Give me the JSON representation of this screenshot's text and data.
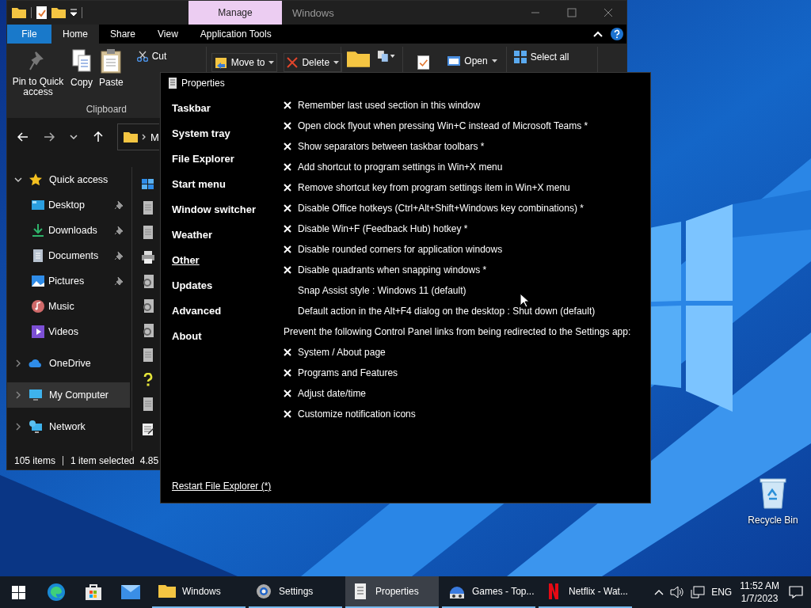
{
  "explorer": {
    "context_tab": "Manage",
    "title": "Windows",
    "ribbon_tabs": [
      {
        "label": "File",
        "kind": "file",
        "selected": false
      },
      {
        "label": "Home",
        "kind": "tab",
        "selected": true
      },
      {
        "label": "Share",
        "kind": "tab",
        "selected": false
      },
      {
        "label": "View",
        "kind": "tab",
        "selected": false
      },
      {
        "label": "Application Tools",
        "kind": "tab",
        "selected": false
      }
    ],
    "ribbon": {
      "pin": "Pin to Quick access",
      "copy": "Copy",
      "paste": "Paste",
      "cut": "Cut",
      "clipboard_label": "Clipboard",
      "move_to": "Move to",
      "delete": "Delete",
      "open": "Open",
      "select_all": "Select all"
    },
    "address": "M",
    "nav": [
      {
        "label": "Quick access",
        "kind": "star",
        "expanded": true,
        "selected": false,
        "children": [
          {
            "label": "Desktop",
            "kind": "desktop",
            "pinned": true,
            "selected": false
          },
          {
            "label": "Downloads",
            "kind": "downloads",
            "pinned": true,
            "selected": false
          },
          {
            "label": "Documents",
            "kind": "documents",
            "pinned": true,
            "selected": false
          },
          {
            "label": "Pictures",
            "kind": "pictures",
            "pinned": true,
            "selected": false
          },
          {
            "label": "Music",
            "kind": "music",
            "pinned": false,
            "selected": false
          },
          {
            "label": "Videos",
            "kind": "videos",
            "pinned": false,
            "selected": false
          }
        ]
      },
      {
        "label": "OneDrive",
        "kind": "cloud",
        "expanded": false,
        "selected": false
      },
      {
        "label": "My Computer",
        "kind": "computer",
        "expanded": false,
        "selected": true
      },
      {
        "label": "Network",
        "kind": "network",
        "expanded": false,
        "selected": false
      }
    ],
    "status": {
      "count": "105 items",
      "selection": "1 item selected",
      "size": "4.85"
    }
  },
  "properties": {
    "title": "Properties",
    "sections": [
      {
        "label": "Taskbar",
        "selected": false
      },
      {
        "label": "System tray",
        "selected": false
      },
      {
        "label": "File Explorer",
        "selected": false
      },
      {
        "label": "Start menu",
        "selected": false
      },
      {
        "label": "Window switcher",
        "selected": false
      },
      {
        "label": "Weather",
        "selected": false
      },
      {
        "label": "Other",
        "selected": true
      },
      {
        "label": "Updates",
        "selected": false
      },
      {
        "label": "Advanced",
        "selected": false
      },
      {
        "label": "About",
        "selected": false
      }
    ],
    "options": [
      {
        "kind": "check",
        "label": "Remember last used section in this window",
        "checked": true
      },
      {
        "kind": "check",
        "label": "Open clock flyout when pressing Win+C instead of Microsoft Teams *",
        "checked": true
      },
      {
        "kind": "check",
        "label": "Show separators between taskbar toolbars *",
        "checked": true
      },
      {
        "kind": "check",
        "label": "Add shortcut to program settings in Win+X menu",
        "checked": true
      },
      {
        "kind": "check",
        "label": "Remove shortcut key from program settings item in Win+X menu",
        "checked": true
      },
      {
        "kind": "check",
        "label": "Disable Office hotkeys (Ctrl+Alt+Shift+Windows key combinations) *",
        "checked": true
      },
      {
        "kind": "check",
        "label": "Disable Win+F (Feedback Hub) hotkey *",
        "checked": true
      },
      {
        "kind": "check",
        "label": "Disable rounded corners for application windows",
        "checked": true
      },
      {
        "kind": "check",
        "label": "Disable quadrants when snapping windows *",
        "checked": true
      },
      {
        "kind": "setting",
        "label": "Snap Assist style : Windows 11 (default)"
      },
      {
        "kind": "setting",
        "label": "Default action in the Alt+F4 dialog on the desktop : Shut down (default)"
      },
      {
        "kind": "heading",
        "label": "Prevent the following Control Panel links from being redirected to the Settings app:"
      },
      {
        "kind": "check",
        "label": "System / About page",
        "checked": true
      },
      {
        "kind": "check",
        "label": "Programs and Features",
        "checked": true
      },
      {
        "kind": "check",
        "label": "Adjust date/time",
        "checked": true
      },
      {
        "kind": "check",
        "label": "Customize notification icons",
        "checked": true
      }
    ],
    "restart_link": "Restart File Explorer (*)"
  },
  "desktop": {
    "icons": [
      {
        "label": "Recycle Bin",
        "kind": "recycle-bin"
      }
    ]
  },
  "taskbar": {
    "tasks": [
      {
        "label": "Windows",
        "kind": "folder",
        "selected": false
      },
      {
        "label": "Settings",
        "kind": "gear",
        "selected": false
      },
      {
        "label": "Properties",
        "kind": "properties",
        "selected": true
      },
      {
        "label": "Games - Top...",
        "kind": "games",
        "selected": false
      },
      {
        "label": "Netflix - Wat...",
        "kind": "netflix",
        "selected": false
      }
    ],
    "language": "ENG",
    "time": "11:52 AM",
    "date": "1/7/2023"
  }
}
